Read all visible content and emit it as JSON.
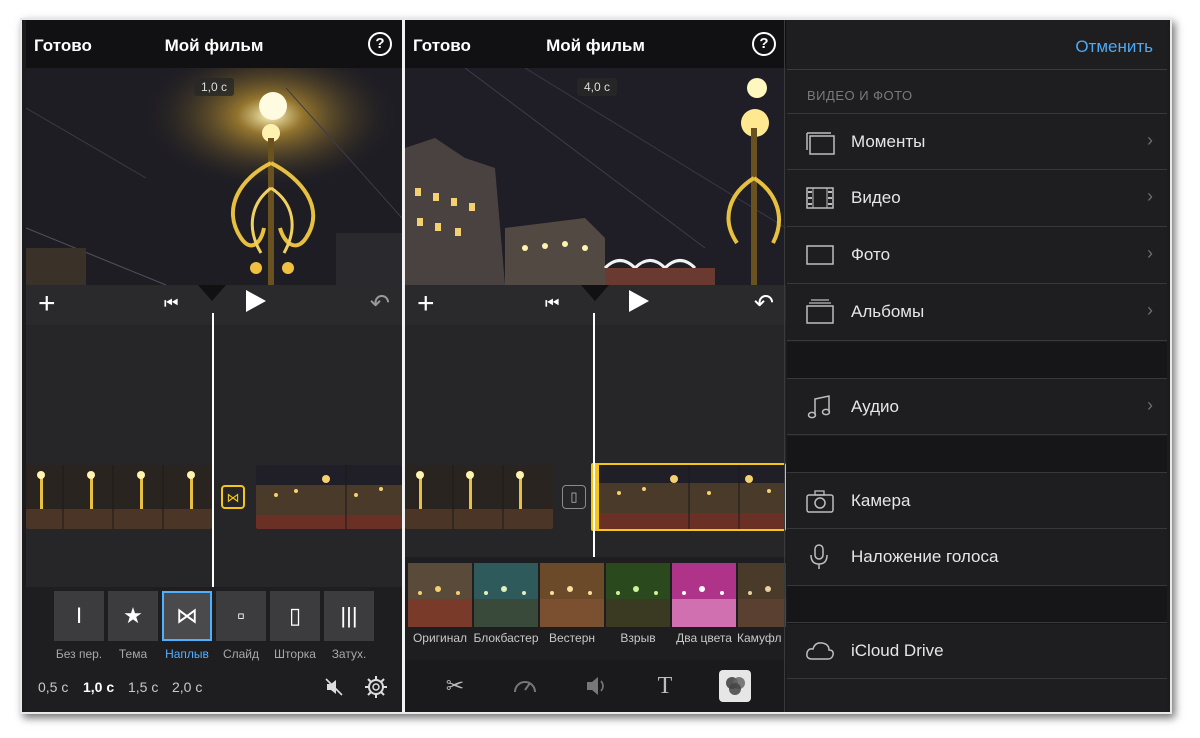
{
  "left_screen": {
    "done_label": "Готово",
    "title": "Мой фильм",
    "help": "?",
    "duration": "1,0 с",
    "plus": "+",
    "transitions": [
      {
        "glyph": "I",
        "label": "Без пер."
      },
      {
        "glyph": "★",
        "label": "Тема"
      },
      {
        "glyph": "⋈",
        "label": "Наплыв",
        "selected": true
      },
      {
        "glyph": "▫",
        "label": "Слайд"
      },
      {
        "glyph": "▯",
        "label": "Шторка"
      },
      {
        "glyph": "|||",
        "label": "Затух."
      }
    ],
    "speeds": [
      "0,5 с",
      "1,0 с",
      "1,5 с",
      "2,0 с"
    ],
    "selected_speed": "1,0 с",
    "icons": [
      "mute-icon",
      "gear-icon"
    ]
  },
  "middle_screen": {
    "done_label": "Готово",
    "title": "Мой фильм",
    "help": "?",
    "duration": "4,0 с",
    "plus": "+",
    "filters": [
      {
        "label": "Оригинал",
        "tint": "#5a4a3a"
      },
      {
        "label": "Блокбастер",
        "tint": "#2f5a5c"
      },
      {
        "label": "Вестерн",
        "tint": "#6a4a28"
      },
      {
        "label": "Взрыв",
        "tint": "#2a4a1e"
      },
      {
        "label": "Два цвета",
        "tint": "#b0338a"
      },
      {
        "label": "Камуфл",
        "tint": "#4a3a2a"
      }
    ],
    "tools": [
      "scissors-icon",
      "speed-icon",
      "volume-icon",
      "title-icon",
      "filters-icon"
    ]
  },
  "right_screen": {
    "cancel_label": "Отменить",
    "section_title": "ВИДЕО И ФОТО",
    "items": [
      {
        "label": "Моменты",
        "icon": "moments-icon",
        "chevron": true
      },
      {
        "label": "Видео",
        "icon": "film-icon",
        "chevron": true
      },
      {
        "label": "Фото",
        "icon": "photo-icon",
        "chevron": true
      },
      {
        "label": "Альбомы",
        "icon": "albums-icon",
        "chevron": true
      },
      {
        "label": "Аудио",
        "icon": "music-icon",
        "chevron": true
      },
      {
        "label": "Камера",
        "icon": "camera-icon",
        "chevron": false
      },
      {
        "label": "Наложение голоса",
        "icon": "mic-icon",
        "chevron": false
      },
      {
        "label": "iCloud Drive",
        "icon": "cloud-icon",
        "chevron": false
      }
    ]
  },
  "colors": {
    "accent_blue": "#4fb0ff",
    "clip_selection": "#f5c518",
    "background": "#262628"
  }
}
